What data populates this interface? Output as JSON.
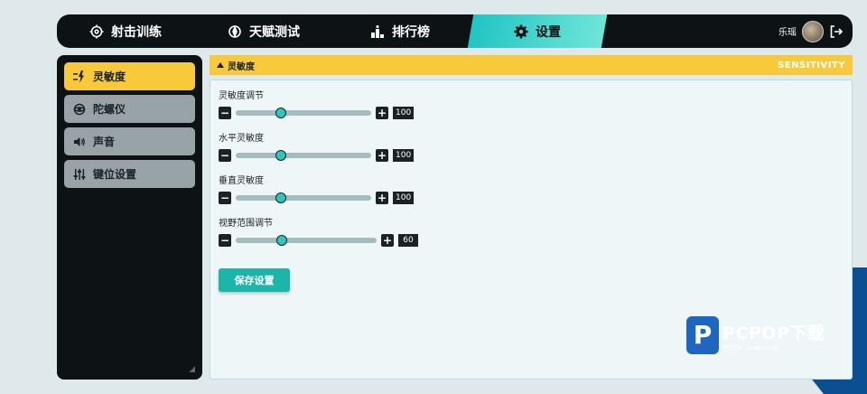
{
  "nav": {
    "items": [
      {
        "label": "射击训练",
        "icon": "crosshair-icon"
      },
      {
        "label": "天赋测试",
        "icon": "compass-icon"
      },
      {
        "label": "排行榜",
        "icon": "podium-icon"
      },
      {
        "label": "设置",
        "icon": "gear-icon"
      }
    ],
    "active": "设置",
    "username": "乐瑶"
  },
  "sidebar": {
    "items": [
      {
        "label": "灵敏度",
        "icon": "sensitivity-icon"
      },
      {
        "label": "陀螺仪",
        "icon": "gyroscope-icon"
      },
      {
        "label": "声音",
        "icon": "speaker-icon"
      },
      {
        "label": "键位设置",
        "icon": "sliders-icon"
      }
    ],
    "active": "灵敏度"
  },
  "section": {
    "title": "灵敏度",
    "title_en": "SENSITIVITY"
  },
  "settings": [
    {
      "label": "灵敏度调节",
      "value": "100",
      "fraction": 0.33
    },
    {
      "label": "水平灵敏度",
      "value": "100",
      "fraction": 0.33
    },
    {
      "label": "垂直灵敏度",
      "value": "100",
      "fraction": 0.33
    },
    {
      "label": "视野范围调节",
      "value": "60",
      "fraction": 0.33
    }
  ],
  "save_label": "保存设置",
  "watermark": {
    "logo": "P",
    "title": "PCPOP下载",
    "subtitle": "PCPOP Download"
  },
  "colors": {
    "accent": "#f9c93c",
    "teal": "#1cb5a9",
    "dark": "#0d1315"
  }
}
